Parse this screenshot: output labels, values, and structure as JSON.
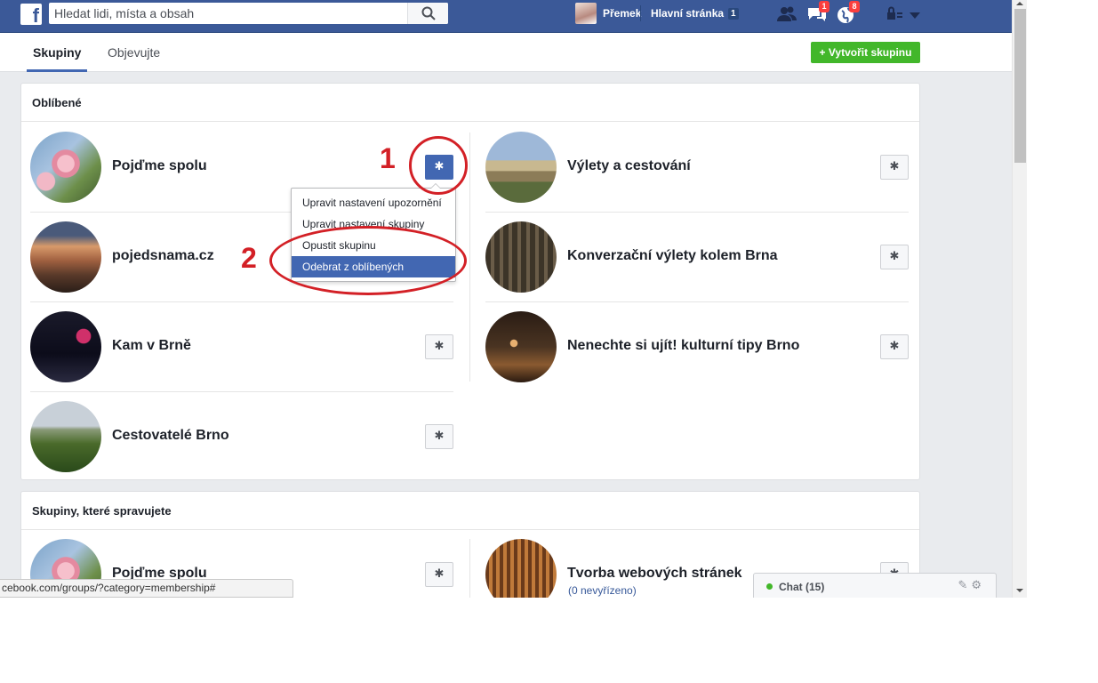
{
  "topbar": {
    "logo": "f",
    "search_placeholder": "Hledat lidi, místa a obsah",
    "user_name": "Přemek",
    "home_label": "Hlavní stránka",
    "home_count": "1",
    "messages_badge": "1",
    "notifications_badge": "8",
    "icons": [
      "friends-icon",
      "messages-icon",
      "notifications-icon",
      "privacy-icon",
      "account-menu-icon"
    ]
  },
  "nav": {
    "tabs": [
      {
        "label": "Skupiny",
        "active": true
      },
      {
        "label": "Objevujte",
        "active": false
      }
    ],
    "create_button": "+ Vytvořit skupinu"
  },
  "favorites": {
    "title": "Oblíbené",
    "groups": [
      {
        "name": "Pojďme spolu"
      },
      {
        "name": "Výlety a cestování"
      },
      {
        "name": "pojedsnama.cz"
      },
      {
        "name": "Konverzační výlety kolem Brna"
      },
      {
        "name": "Kam v Brně"
      },
      {
        "name": "Nenechte si ujít! kulturní tipy Brno"
      },
      {
        "name": "Cestovatelé Brno"
      }
    ]
  },
  "dropdown": {
    "items": [
      "Upravit nastavení upozornění",
      "Upravit nastavení skupiny",
      "Opustit skupinu",
      "Odebrat z oblíbených"
    ],
    "highlighted": "Odebrat z oblíbených"
  },
  "managed": {
    "title": "Skupiny, které spravujete",
    "groups": [
      {
        "name": "Pojďme spolu"
      },
      {
        "name": "Tvorba webových stránek",
        "sub": "(0 nevyřízeno)"
      }
    ]
  },
  "annotations": {
    "one": "1",
    "two": "2",
    "color": "#d32026"
  },
  "status_bar": "cebook.com/groups/?category=membership#",
  "chat": {
    "label": "Chat (15)",
    "status_color": "#42b72a"
  },
  "colors": {
    "brand": "#3b5998",
    "accent": "#4267b2",
    "green": "#42b72a",
    "badge": "#fa3e3e"
  }
}
